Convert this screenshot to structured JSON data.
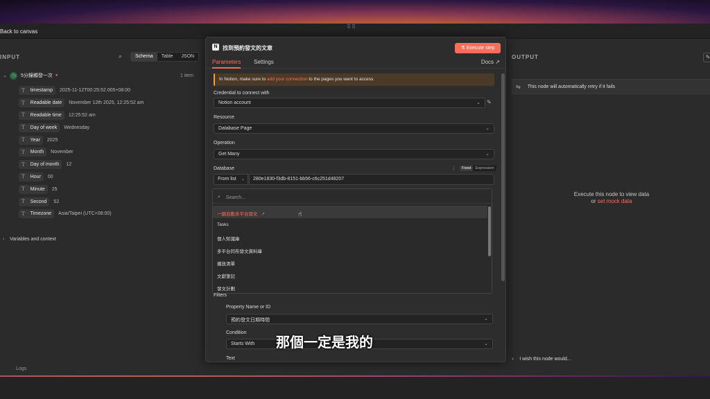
{
  "topbar": {
    "back_label": "Back to canvas"
  },
  "input": {
    "title": "INPUT",
    "views": [
      "Schema",
      "Table",
      "JSON"
    ],
    "active_view": "Schema",
    "root": {
      "label": "5分鐘觸發一次",
      "count": "1 item"
    },
    "fields": [
      {
        "name": "timestamp",
        "value": "2025-11-12T00:25:52.005+08:00"
      },
      {
        "name": "Readable date",
        "value": "November 12th 2025, 12:25:52 am"
      },
      {
        "name": "Readable time",
        "value": "12:25:52 am"
      },
      {
        "name": "Day of week",
        "value": "Wednesday"
      },
      {
        "name": "Year",
        "value": "2025"
      },
      {
        "name": "Month",
        "value": "November"
      },
      {
        "name": "Day of month",
        "value": "12"
      },
      {
        "name": "Hour",
        "value": "00"
      },
      {
        "name": "Minute",
        "value": "25"
      },
      {
        "name": "Second",
        "value": "52"
      },
      {
        "name": "Timezone",
        "value": "Asia/Taipei (UTC+08:00)"
      }
    ],
    "vars_label": "Variables and context"
  },
  "modal": {
    "title": "找到預約發文的文章",
    "execute_label": "Execute step",
    "tabs": [
      "Parameters",
      "Settings"
    ],
    "docs_label": "Docs",
    "notice": {
      "prefix": "In Notion, make sure to ",
      "link": "add your connection",
      "suffix": " to the pages you want to access."
    },
    "credential": {
      "label": "Credential to connect with",
      "value": "Notion account"
    },
    "resource": {
      "label": "Resource",
      "value": "Database Page"
    },
    "operation": {
      "label": "Operation",
      "value": "Get Many"
    },
    "database": {
      "label": "Database",
      "mode_fixed": "Fixed",
      "mode_expression": "Expression",
      "source": "From list",
      "id": "280e1830-f3db-8151-bb56-c6c251d48207"
    },
    "dropdown": {
      "placeholder": "Search...",
      "items": [
        "一鍵自動多平台發文",
        "Tasks",
        "個人知識庫",
        "多平台同布發文資料庫",
        "播放清單",
        "文獻筆記",
        "發文計劃"
      ]
    },
    "filters": {
      "label": "Filters",
      "property_label": "Property Name or ID",
      "property_value": "預約發文日期時間",
      "condition_label": "Condition",
      "condition_value": "Starts With",
      "text_label": "Text"
    }
  },
  "output": {
    "title": "OUTPUT",
    "retry_text": "This node will automatically retry if it fails",
    "empty_line1": "Execute this node to view data",
    "empty_or": "or ",
    "empty_link": "set mock data",
    "wish_text": "I wish this node would..."
  },
  "bottom": {
    "logs_label": "Logs"
  },
  "subtitle": "那個一定是我的",
  "colors": {
    "accent": "#ff6d5a",
    "panel": "#2d2d2d",
    "background": "#2b2b2b"
  }
}
